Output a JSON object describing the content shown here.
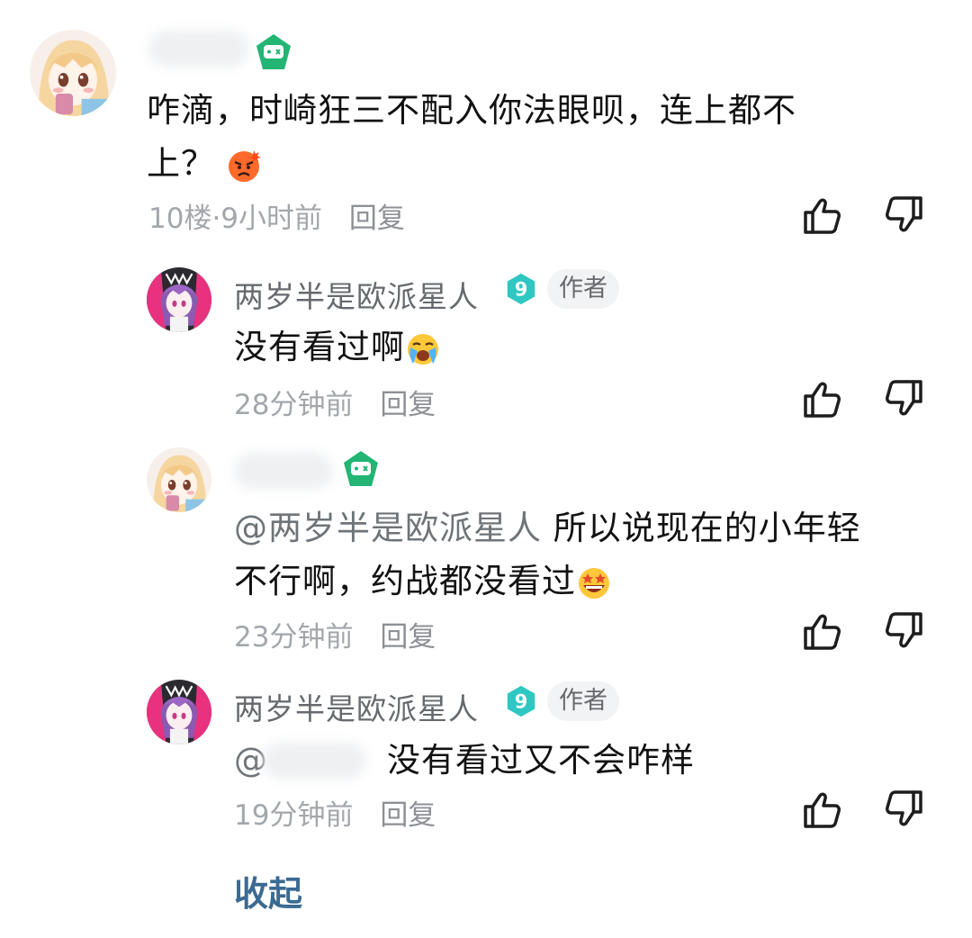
{
  "thread": {
    "collapse_label": "收起",
    "comments": [
      {
        "id": "main",
        "text_line1": "咋滴，时崎狂三不配入你法眼呗，连上都不",
        "text_line2": "上？",
        "emoji": "angry-face",
        "meta_floor": "10楼·9小时前",
        "reply_label": "回复"
      },
      {
        "id": "reply1",
        "user": "两岁半是欧派星人",
        "level": "9",
        "author_tag": "作者",
        "text": "没有看过啊",
        "emoji": "crying-face",
        "meta_time": "28分钟前",
        "reply_label": "回复"
      },
      {
        "id": "reply2",
        "mention": "@两岁半是欧派星人",
        "text_line1": "所以说现在的小年轻",
        "text_line2": "不行啊，约战都没看过",
        "emoji": "grinning-star-eyes-face",
        "meta_time": "23分钟前",
        "reply_label": "回复"
      },
      {
        "id": "reply3",
        "user": "两岁半是欧派星人",
        "level": "9",
        "author_tag": "作者",
        "mention": "@",
        "text": "没有看过又不会咋样",
        "meta_time": "19分钟前",
        "reply_label": "回复"
      }
    ]
  },
  "colors": {
    "level_badge": "#2ec7c2",
    "green_badge": "#22b573",
    "link": "#3b6a92"
  }
}
